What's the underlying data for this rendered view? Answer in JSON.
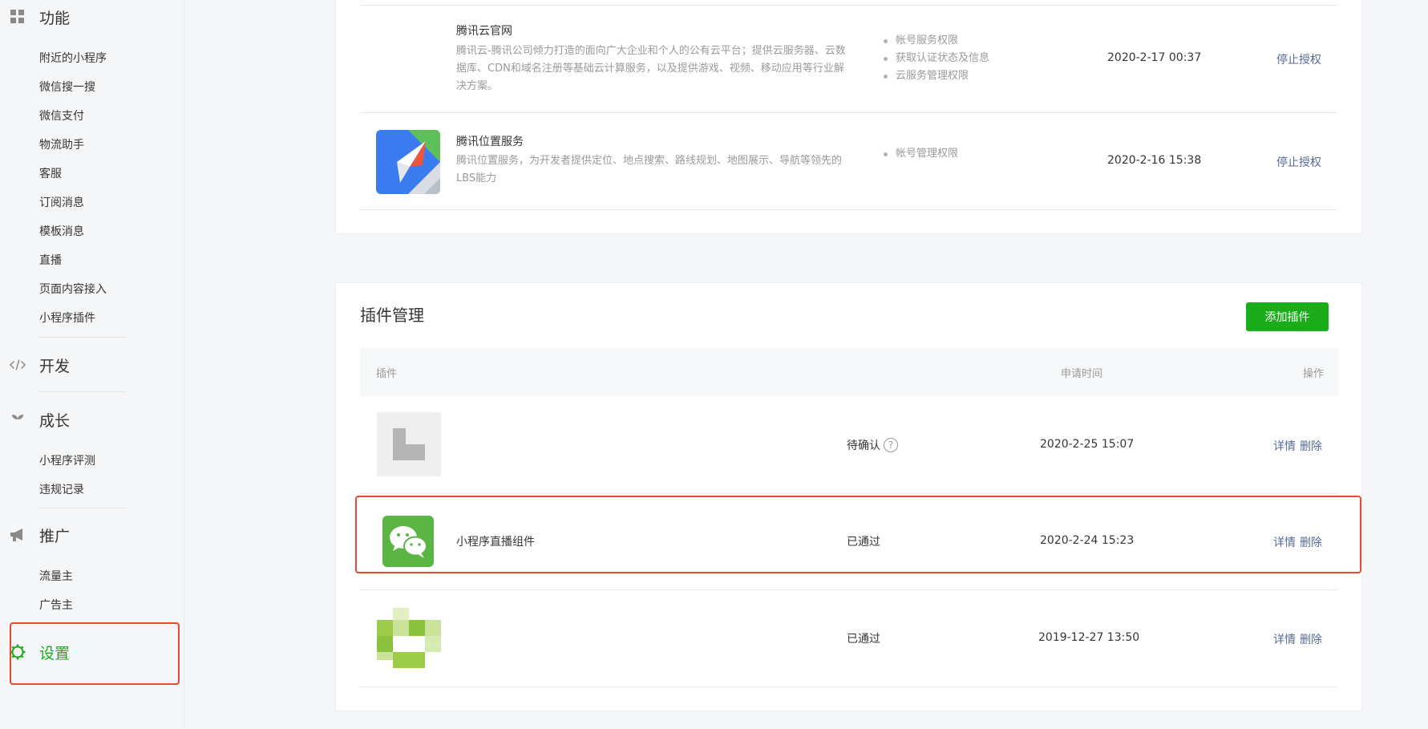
{
  "sidebar": {
    "features": {
      "title": "功能",
      "items": [
        "附近的小程序",
        "微信搜一搜",
        "微信支付",
        "物流助手",
        "客服",
        "订阅消息",
        "模板消息",
        "直播",
        "页面内容接入",
        "小程序插件"
      ]
    },
    "develop": {
      "title": "开发"
    },
    "growth": {
      "title": "成长",
      "items": [
        "小程序评测",
        "违规记录"
      ]
    },
    "promote": {
      "title": "推广",
      "items": [
        "流量主",
        "广告主"
      ]
    },
    "settings": {
      "title": "设置"
    }
  },
  "authorized_services": [
    {
      "name": "腾讯云官网",
      "description": "腾讯云-腾讯公司倾力打造的面向广大企业和个人的公有云平台；提供云服务器、云数据库、CDN和域名注册等基础云计算服务，以及提供游戏、视频、移动应用等行业解决方案。",
      "permissions": [
        "帐号服务权限",
        "获取认证状态及信息",
        "云服务管理权限"
      ],
      "time": "2020-2-17 00:37",
      "action": "停止授权"
    },
    {
      "name": "腾讯位置服务",
      "description": "腾讯位置服务，为开发者提供定位、地点搜索、路线规划、地图展示、导航等领先的LBS能力",
      "permissions": [
        "帐号管理权限"
      ],
      "time": "2020-2-16 15:38",
      "action": "停止授权"
    }
  ],
  "plugin_management": {
    "title": "插件管理",
    "add_button": "添加插件",
    "columns": {
      "plugin": "插件",
      "time": "申请时间",
      "action": "操作"
    },
    "rows": [
      {
        "name": "",
        "status": "待确认",
        "help": "?",
        "time": "2020-2-25 15:07",
        "detail": "详情",
        "delete": "删除"
      },
      {
        "name": "小程序直播组件",
        "status": "已通过",
        "time": "2020-2-24 15:23",
        "detail": "详情",
        "delete": "删除"
      },
      {
        "name": "",
        "status": "已通过",
        "time": "2019-12-27 13:50",
        "detail": "详情",
        "delete": "删除"
      }
    ]
  },
  "colors": {
    "accent_green": "#1aad19",
    "link_blue": "#576b95",
    "highlight_red": "#e64a30"
  }
}
